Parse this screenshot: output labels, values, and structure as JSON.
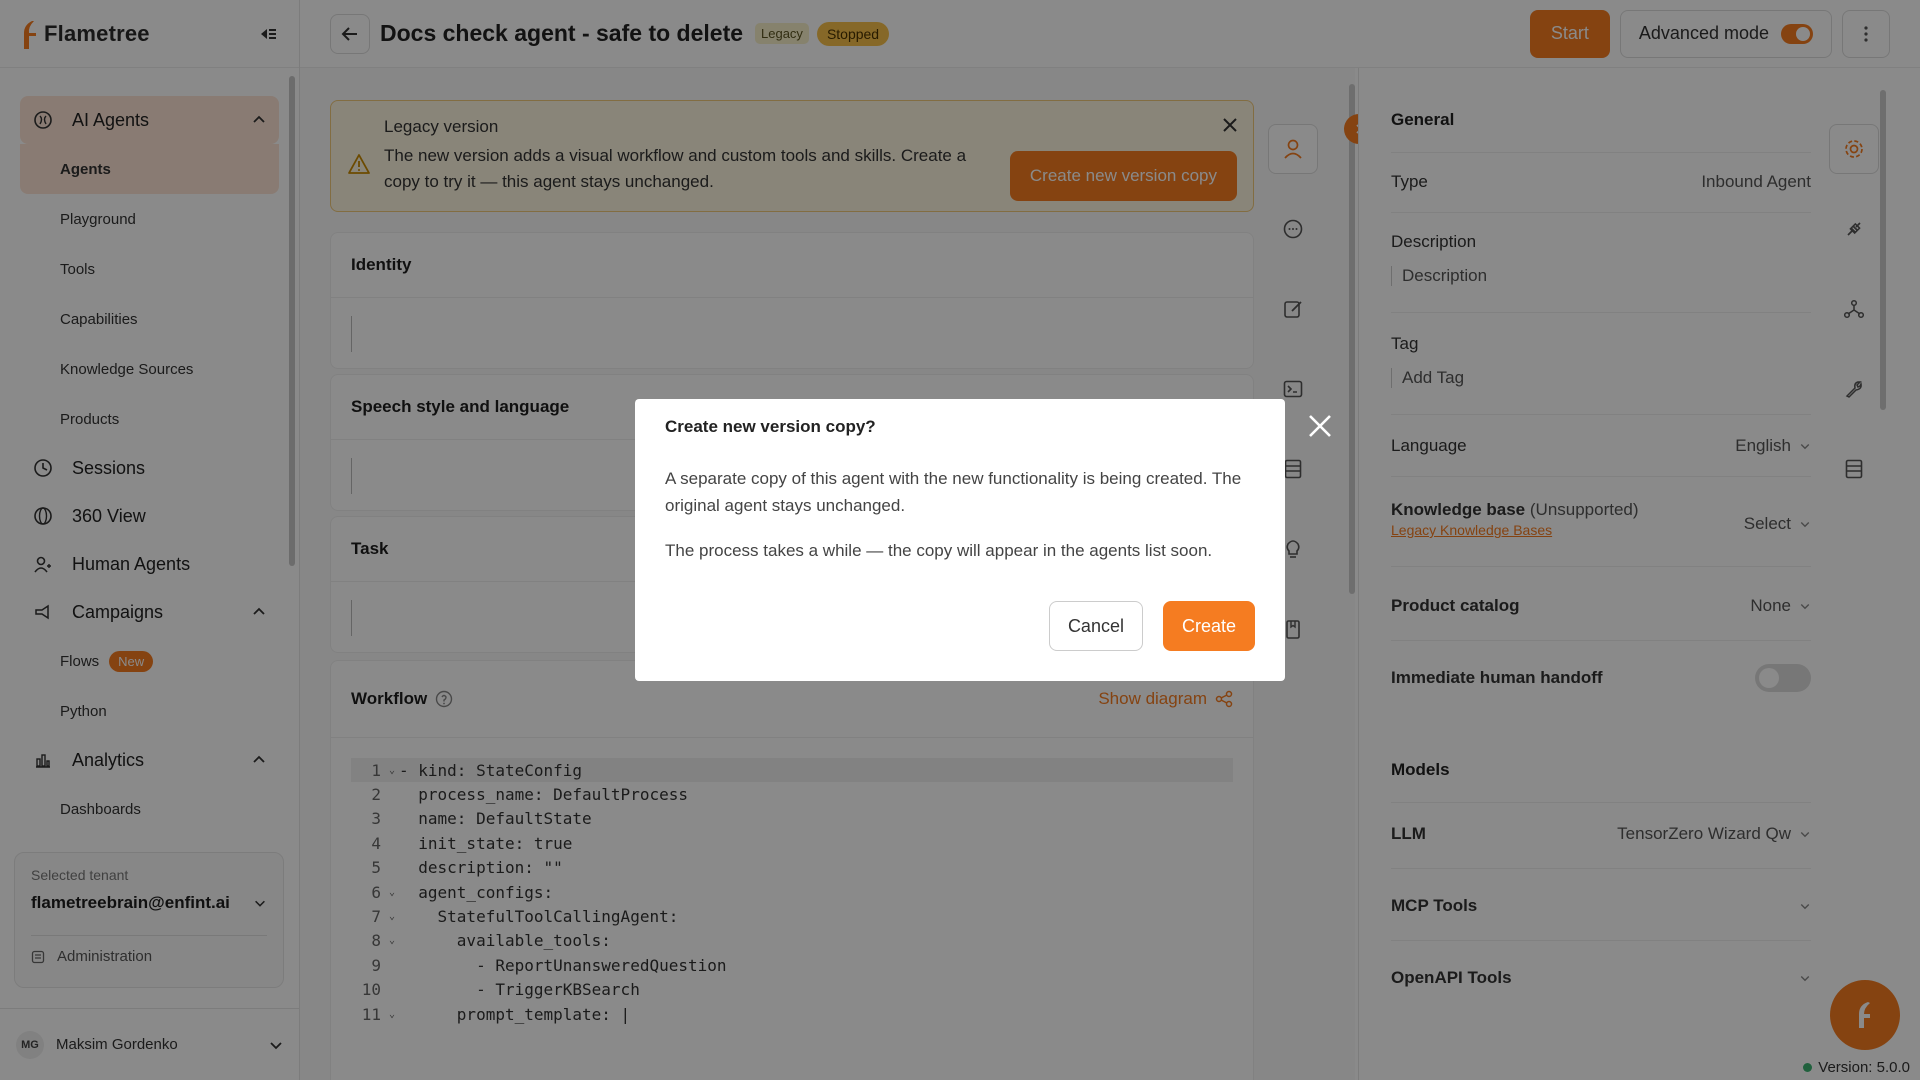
{
  "app": {
    "name": "Flametree",
    "version": "Version: 5.0.0"
  },
  "sidebar": {
    "groups": [
      {
        "label": "AI Agents",
        "icon": "brain-icon",
        "expanded": true,
        "items": [
          "Agents",
          "Playground",
          "Tools",
          "Capabilities",
          "Knowledge Sources",
          "Products"
        ]
      },
      {
        "label": "Sessions",
        "icon": "history-icon"
      },
      {
        "label": "360 View",
        "icon": "globe-icon"
      },
      {
        "label": "Human Agents",
        "icon": "users-icon"
      },
      {
        "label": "Campaigns",
        "icon": "megaphone-icon",
        "expanded": true,
        "items": [
          "Flows",
          "Python"
        ],
        "badge": "New"
      },
      {
        "label": "Analytics",
        "icon": "bar-chart-icon",
        "expanded": true,
        "items": [
          "Dashboards"
        ]
      }
    ],
    "tenant": {
      "label": "Selected tenant",
      "value": "flametreebrain@enfint.ai",
      "admin": "Administration"
    },
    "user": {
      "initials": "MG",
      "name": "Maksim Gordenko"
    }
  },
  "header": {
    "title": "Docs check agent - safe to delete",
    "tag_legacy": "Legacy",
    "tag_status": "Stopped",
    "start_label": "Start",
    "advanced_label": "Advanced mode"
  },
  "banner": {
    "title": "Legacy version",
    "text": "The new version adds a visual workflow and custom tools and skills. Create a copy to try it — this agent stays unchanged.",
    "button": "Create new version copy"
  },
  "sections": {
    "identity": "Identity",
    "speech": "Speech style and language",
    "task": "Task",
    "workflow": "Workflow",
    "show_diagram": "Show diagram"
  },
  "code": [
    {
      "n": "1",
      "fold": true,
      "t": "- kind: StateConfig"
    },
    {
      "n": "2",
      "fold": false,
      "t": "  process_name: DefaultProcess"
    },
    {
      "n": "3",
      "fold": false,
      "t": "  name: DefaultState"
    },
    {
      "n": "4",
      "fold": false,
      "t": "  init_state: true"
    },
    {
      "n": "5",
      "fold": false,
      "t": "  description: \"\""
    },
    {
      "n": "6",
      "fold": true,
      "t": "  agent_configs:"
    },
    {
      "n": "7",
      "fold": true,
      "t": "    StatefulToolCallingAgent:"
    },
    {
      "n": "8",
      "fold": true,
      "t": "      available_tools:"
    },
    {
      "n": "9",
      "fold": false,
      "t": "        - ReportUnansweredQuestion"
    },
    {
      "n": "10",
      "fold": false,
      "t": "        - TriggerKBSearch"
    },
    {
      "n": "11",
      "fold": true,
      "t": "      prompt_template: |"
    }
  ],
  "right_panel": {
    "general": "General",
    "type_label": "Type",
    "type_value": "Inbound Agent",
    "description_label": "Description",
    "description_placeholder": "Description",
    "tag_label": "Tag",
    "tag_placeholder": "Add Tag",
    "language_label": "Language",
    "language_value": "English",
    "kb_label": "Knowledge base",
    "kb_note": "(Unsupported)",
    "kb_link": "Legacy Knowledge Bases",
    "kb_value": "Select",
    "catalog_label": "Product catalog",
    "catalog_value": "None",
    "handoff_label": "Immediate human handoff",
    "models": "Models",
    "llm_label": "LLM",
    "llm_value": "TensorZero Wizard Qw",
    "mcp_label": "MCP Tools",
    "openapi_label": "OpenAPI Tools"
  },
  "modal": {
    "title": "Create new version copy?",
    "p1": "A separate copy of this agent with the new functionality is being created. The original agent stays unchanged.",
    "p2": "The process takes a while — the copy will appear in the agents list soon.",
    "cancel": "Cancel",
    "create": "Create"
  },
  "colors": {
    "accent": "#f57c21",
    "legacy_bg": "#fdf5df",
    "stopped": "#f7c14a"
  }
}
